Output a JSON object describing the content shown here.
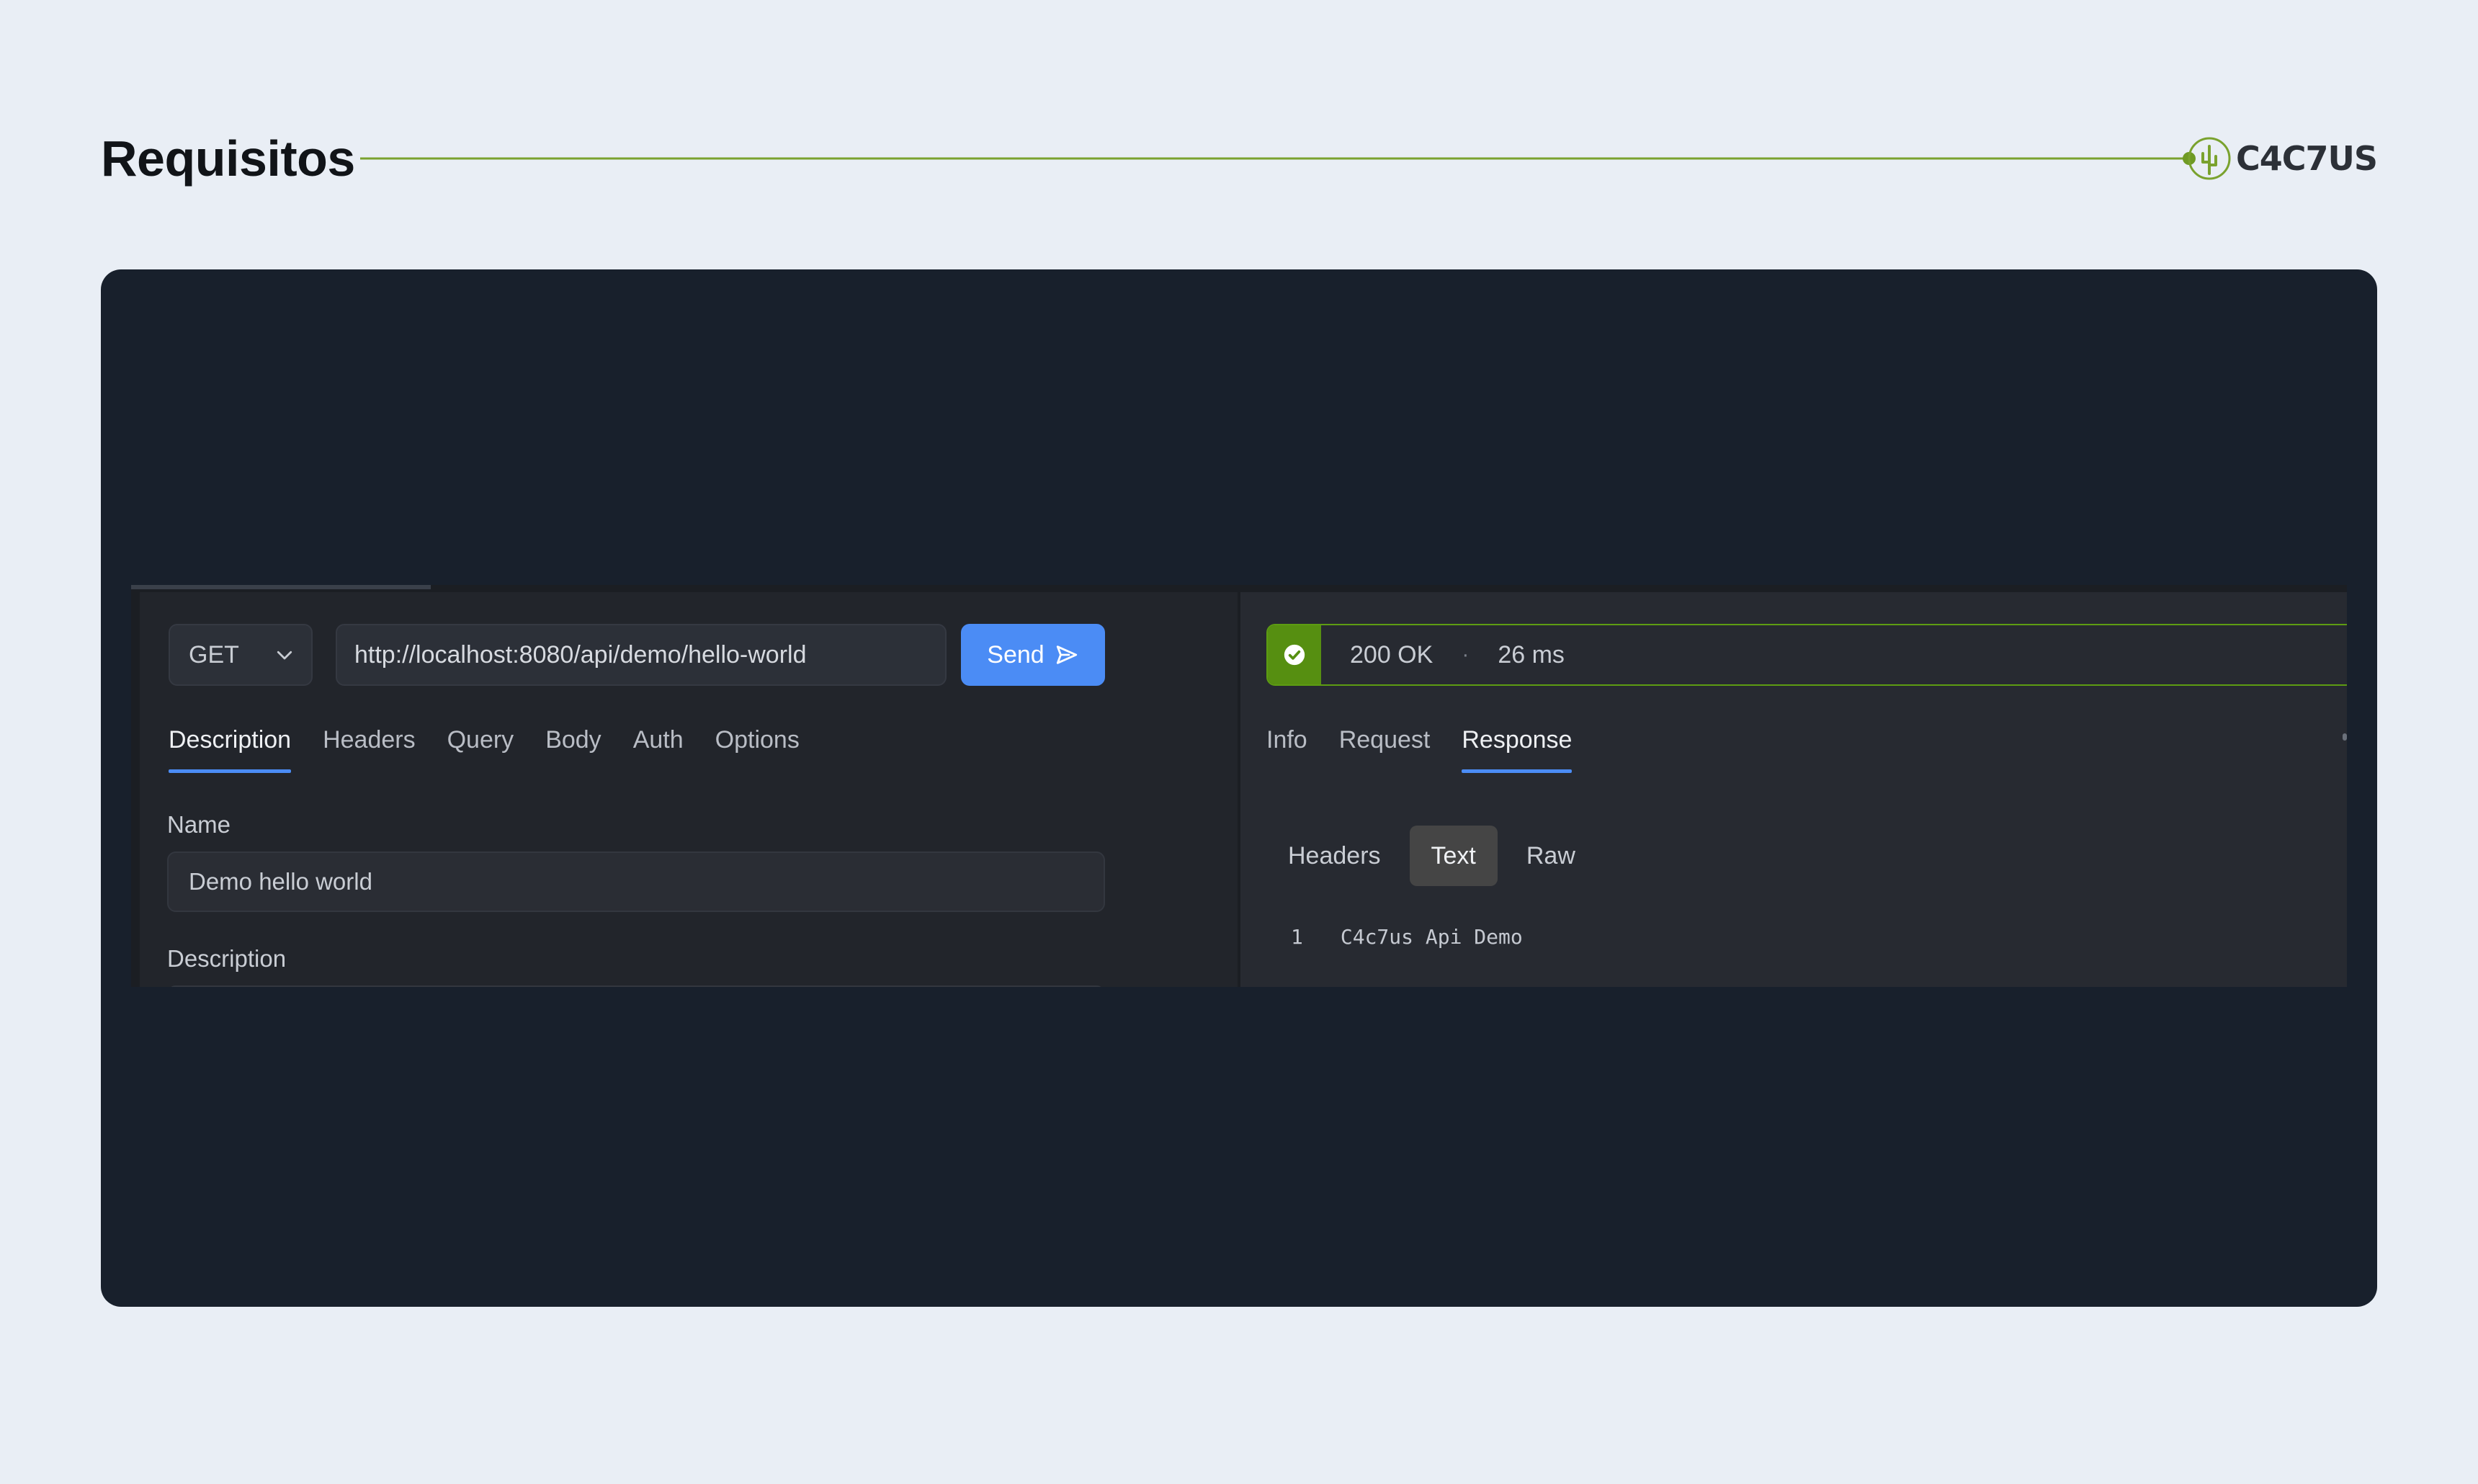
{
  "header": {
    "title": "Requisitos",
    "logo_text": "C4C7US",
    "accent_color": "#7aa22e"
  },
  "request": {
    "method": "GET",
    "url": "http://localhost:8080/api/demo/hello-world",
    "send_label": "Send",
    "tabs": [
      {
        "label": "Description",
        "active": true
      },
      {
        "label": "Headers"
      },
      {
        "label": "Query"
      },
      {
        "label": "Body"
      },
      {
        "label": "Auth"
      },
      {
        "label": "Options"
      }
    ],
    "name_label": "Name",
    "name_value": "Demo hello world",
    "description_label": "Description"
  },
  "response": {
    "status": "200 OK",
    "separator": "·",
    "time": "26 ms",
    "status_color": "#568f11",
    "tabs": [
      {
        "label": "Info"
      },
      {
        "label": "Request"
      },
      {
        "label": "Response",
        "active": true
      }
    ],
    "subtabs": [
      {
        "label": "Headers"
      },
      {
        "label": "Text",
        "active": true
      },
      {
        "label": "Raw"
      }
    ],
    "body_lines": [
      {
        "number": "1",
        "text": "C4c7us Api Demo"
      }
    ]
  },
  "icons": {
    "logo": "cactus-logo-icon",
    "method_dropdown": "chevron-down-icon",
    "send": "paper-plane-icon",
    "status": "check-circle-icon"
  },
  "colors": {
    "primary_button": "#4b8cf5",
    "card_background": "#18202c"
  }
}
